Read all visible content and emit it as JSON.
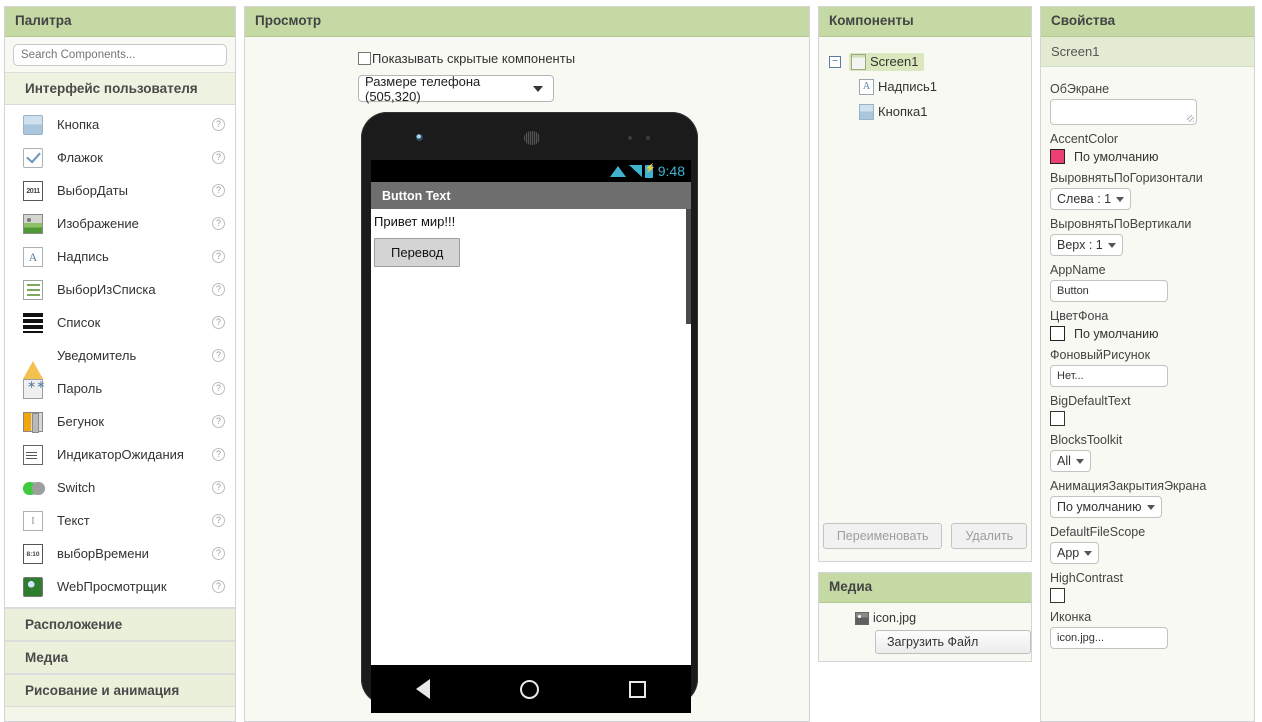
{
  "palette": {
    "title": "Палитра",
    "search_placeholder": "Search Components...",
    "open_category": "Интерфейс пользователя",
    "help_glyph": "?",
    "components": [
      {
        "label": "Кнопка",
        "icon": "button-icon"
      },
      {
        "label": "Флажок",
        "icon": "checkbox-icon"
      },
      {
        "label": "ВыборДаты",
        "icon": "datepicker-icon",
        "glyph": "2011"
      },
      {
        "label": "Изображение",
        "icon": "image-icon"
      },
      {
        "label": "Надпись",
        "icon": "label-icon",
        "glyph": "A"
      },
      {
        "label": "ВыборИзСписка",
        "icon": "listpicker-icon"
      },
      {
        "label": "Список",
        "icon": "listview-icon"
      },
      {
        "label": "Уведомитель",
        "icon": "notifier-icon"
      },
      {
        "label": "Пароль",
        "icon": "passwordbox-icon"
      },
      {
        "label": "Бегунок",
        "icon": "slider-icon"
      },
      {
        "label": "ИндикаторОжидания",
        "icon": "spinner-icon"
      },
      {
        "label": "Switch",
        "icon": "switch-icon"
      },
      {
        "label": "Текст",
        "icon": "textbox-icon",
        "glyph": "I"
      },
      {
        "label": "выборВремени",
        "icon": "timepicker-icon",
        "glyph": "8:10"
      },
      {
        "label": "WebПросмотрщик",
        "icon": "webviewer-icon"
      }
    ],
    "collapsed_categories": [
      "Расположение",
      "Медиа",
      "Рисование и анимация"
    ]
  },
  "viewer": {
    "title": "Просмотр",
    "show_hidden_label": "Показывать скрытые компоненты",
    "show_hidden_checked": false,
    "size_select_value": "Размере телефона (505,320)",
    "phone": {
      "status_time": "9:48",
      "status_icons": [
        "wifi-icon",
        "signal-icon",
        "battery-icon"
      ],
      "status_icon_color": "#3fb3cf",
      "app_title": "Button Text",
      "titlebar_color": "#6e6e6e",
      "label_text": "Привет мир!!!",
      "button_text": "Перевод",
      "nav_icons": [
        "back-icon",
        "home-icon",
        "recents-icon"
      ]
    }
  },
  "components": {
    "title": "Компоненты",
    "toggle_glyph": "−",
    "tree": [
      {
        "label": "Screen1",
        "icon": "screen-icon",
        "selected": true,
        "depth": 0
      },
      {
        "label": "Надпись1",
        "icon": "label-icon",
        "selected": false,
        "depth": 1
      },
      {
        "label": "Кнопка1",
        "icon": "button-icon",
        "selected": false,
        "depth": 1
      }
    ],
    "rename_label": "Переименовать",
    "delete_label": "Удалить"
  },
  "media": {
    "title": "Медиа",
    "files": [
      {
        "name": "icon.jpg",
        "icon": "image-file-icon"
      }
    ],
    "upload_label": "Загрузить Файл"
  },
  "properties": {
    "title": "Свойства",
    "selected_component": "Screen1",
    "items": [
      {
        "label": "ОбЭкране",
        "type": "textarea",
        "value": ""
      },
      {
        "label": "AccentColor",
        "type": "color",
        "value": "По умолчанию",
        "swatch": "#ec4073"
      },
      {
        "label": "ВыровнятьПоГоризонтали",
        "type": "dropdown",
        "value": "Слева : 1"
      },
      {
        "label": "ВыровнятьПоВертикали",
        "type": "dropdown",
        "value": "Верх : 1"
      },
      {
        "label": "AppName",
        "type": "input",
        "value": "Button"
      },
      {
        "label": "ЦветФона",
        "type": "color",
        "value": "По умолчанию",
        "swatch": "#ffffff"
      },
      {
        "label": "ФоновыйРисунок",
        "type": "input",
        "value": "Нет..."
      },
      {
        "label": "BigDefaultText",
        "type": "checkbox",
        "value": ""
      },
      {
        "label": "BlocksToolkit",
        "type": "dropdown",
        "value": "All"
      },
      {
        "label": "АнимацияЗакрытияЭкрана",
        "type": "dropdown",
        "value": "По умолчанию"
      },
      {
        "label": "DefaultFileScope",
        "type": "dropdown",
        "value": "App"
      },
      {
        "label": "HighContrast",
        "type": "checkbox",
        "value": ""
      },
      {
        "label": "Иконка",
        "type": "input",
        "value": "icon.jpg..."
      }
    ]
  }
}
